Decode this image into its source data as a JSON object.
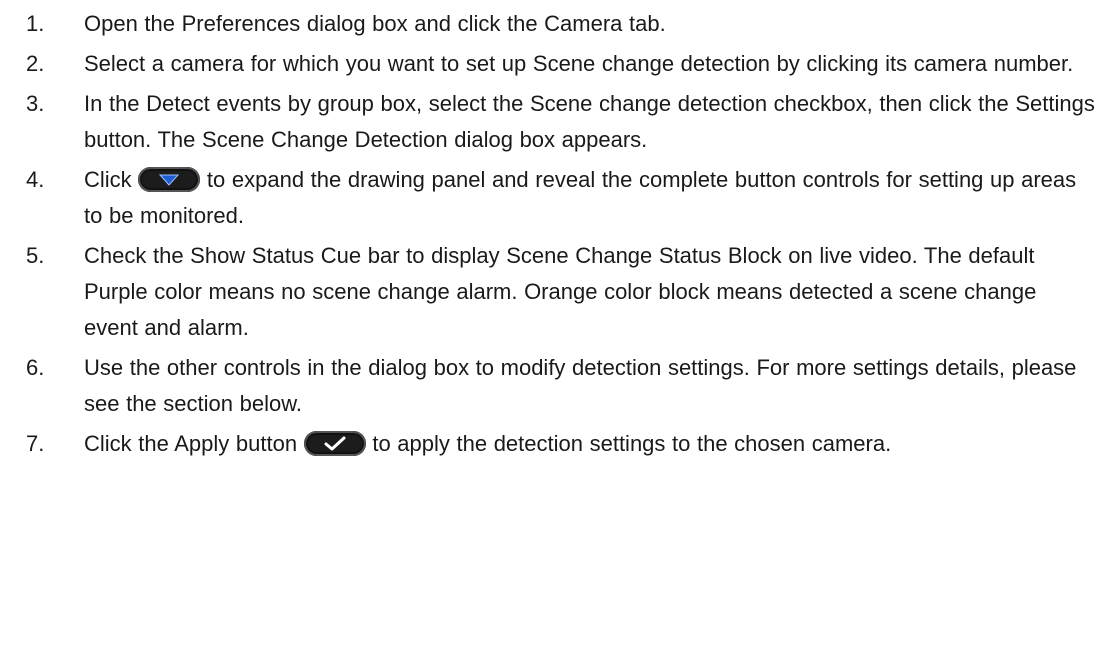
{
  "steps": [
    {
      "num": "1.",
      "text": "Open the Preferences dialog box and click the Camera tab."
    },
    {
      "num": "2.",
      "text": "Select a camera for which you want to set up Scene change detection by clicking its camera number."
    },
    {
      "num": "3.",
      "text": "In the Detect events by group box, select the Scene change detection checkbox, then click the Settings button. The Scene Change Detection dialog box appears."
    },
    {
      "num": "4.",
      "before": "Click",
      "after": "to expand the drawing panel and reveal the complete button controls for setting up areas to be monitored.",
      "icon": "expand-down-icon"
    },
    {
      "num": "5.",
      "text": "Check the Show Status Cue bar to display Scene Change Status Block on live video. The default Purple color means no scene change alarm. Orange color block means detected a scene change event and alarm."
    },
    {
      "num": "6.",
      "text": "Use the other controls in the dialog box to modify detection settings. For more settings details, please see the section below."
    },
    {
      "num": "7.",
      "before": "Click the Apply button",
      "after": "to apply the detection settings to the chosen camera.",
      "icon": "apply-check-icon"
    }
  ],
  "colors": {
    "text": "#1a1a1a",
    "button_bg": "#1c1c1c",
    "icon_fg": "#1f5fd6"
  }
}
